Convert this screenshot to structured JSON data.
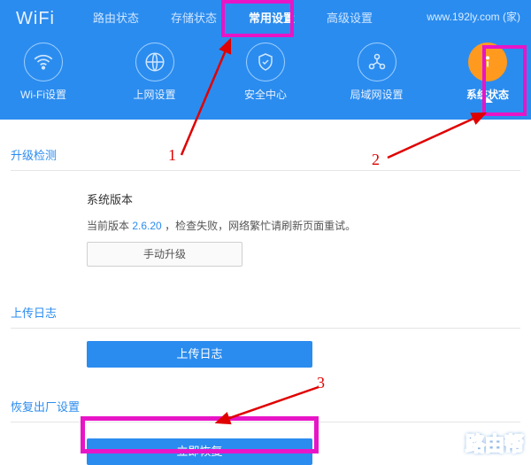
{
  "header": {
    "logo": "WiFi",
    "top_tabs": [
      "路由状态",
      "存储状态",
      "常用设置",
      "高级设置"
    ],
    "active_top_tab": "常用设置",
    "url_label": "www.192ly.com (家)"
  },
  "icons": [
    {
      "label": "Wi-Fi设置",
      "name": "wifi"
    },
    {
      "label": "上网设置",
      "name": "globe"
    },
    {
      "label": "安全中心",
      "name": "shield"
    },
    {
      "label": "局域网设置",
      "name": "lan"
    },
    {
      "label": "系统状态",
      "name": "info",
      "active": true
    }
  ],
  "sections": {
    "upgrade": {
      "title": "升级检测",
      "heading": "系统版本",
      "line_prefix": "当前版本",
      "version": "2.6.20",
      "line_suffix": "，检查失败，网络繁忙请刷新页面重试。",
      "button": "手动升级"
    },
    "upload": {
      "title": "上传日志",
      "button": "上传日志"
    },
    "restore": {
      "title": "恢复出厂设置",
      "button": "立即恢复"
    }
  },
  "annotations": {
    "n1": "1",
    "n2": "2",
    "n3": "3"
  },
  "watermark": "路由帮"
}
